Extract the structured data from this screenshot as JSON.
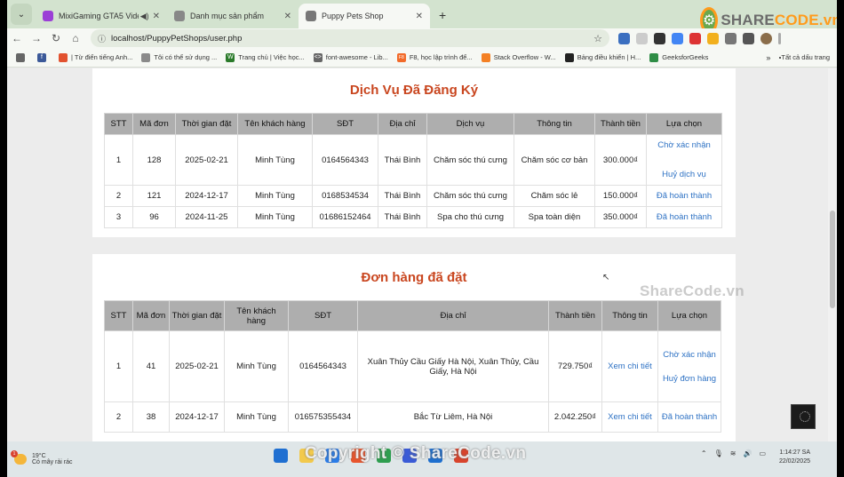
{
  "browser": {
    "tabs": [
      {
        "title": "MixiGaming GTA5 Video Pl",
        "color": "#9b3fd6",
        "audio": "◀)",
        "active": false
      },
      {
        "title": "Danh mục sản phẩm",
        "color": "#888888",
        "active": false
      },
      {
        "title": "Puppy Pets Shop",
        "color": "#777777",
        "active": true
      }
    ],
    "new_tab": "+",
    "url": "localhost/PuppyPetShops/user.php",
    "bookmarks": [
      {
        "label": "",
        "color": "#3b5998",
        "glyph": "f"
      },
      {
        "label": "| Từ điển tiếng Anh...",
        "color": "#e2522f",
        "glyph": ""
      },
      {
        "label": "Tôi có thể sử dụng ...",
        "color": "#8a8a8a",
        "glyph": ""
      },
      {
        "label": "Trang chủ | Việc học...",
        "color": "#2a7a2a",
        "glyph": "W"
      },
      {
        "label": "font-awesome - Lib...",
        "color": "#666666",
        "glyph": "<>"
      },
      {
        "label": "F8, học lập trình để...",
        "color": "#f26a2a",
        "glyph": "F8"
      },
      {
        "label": "Stack Overflow - W...",
        "color": "#f48024",
        "glyph": ""
      },
      {
        "label": "Bảng điều khiển | H...",
        "color": "#222222",
        "glyph": ""
      },
      {
        "label": "GeeksforGeeks",
        "color": "#2f8d46",
        "glyph": ""
      }
    ],
    "bookmarks_more": "»",
    "all_bookmarks": "Tất cả dấu trang"
  },
  "logo": {
    "brand_left": "SHARE",
    "brand_right": "CODE.vn"
  },
  "services": {
    "title": "Dịch Vụ Đã Đăng Ký",
    "headers": [
      "STT",
      "Mã đơn",
      "Thời gian đặt",
      "Tên khách hàng",
      "SĐT",
      "Địa chỉ",
      "Dịch vụ",
      "Thông tin",
      "Thành tiền",
      "Lựa chọn"
    ],
    "rows": [
      {
        "stt": "1",
        "id": "128",
        "date": "2025-02-21",
        "name": "Minh Tùng",
        "phone": "0164564343",
        "address": "Thái Bình",
        "service": "Chăm sóc thú cưng",
        "info": "Chăm sóc cơ bản",
        "total": "300.000₫",
        "action1": "Chờ xác nhận",
        "action2": "Huỷ dịch vụ"
      },
      {
        "stt": "2",
        "id": "121",
        "date": "2024-12-17",
        "name": "Minh Tùng",
        "phone": "0168534534",
        "address": "Thái Bình",
        "service": "Chăm sóc thú cưng",
        "info": "Chăm sóc lẻ",
        "total": "150.000₫",
        "action1": "Đã hoàn thành",
        "action2": ""
      },
      {
        "stt": "3",
        "id": "96",
        "date": "2024-11-25",
        "name": "Minh Tùng",
        "phone": "01686152464",
        "address": "Thái Bình",
        "service": "Spa cho thú cưng",
        "info": "Spa toàn diện",
        "total": "350.000₫",
        "action1": "Đã hoàn thành",
        "action2": ""
      }
    ]
  },
  "orders": {
    "title": "Đơn hàng đã đặt",
    "headers": [
      "STT",
      "Mã đơn",
      "Thời gian đặt",
      "Tên khách hàng",
      "SĐT",
      "Địa chỉ",
      "Thành tiền",
      "Thông tin",
      "Lựa chọn"
    ],
    "rows": [
      {
        "stt": "1",
        "id": "41",
        "date": "2025-02-21",
        "name": "Minh Tùng",
        "phone": "0164564343",
        "address": "Xuân Thủy Cầu Giấy Hà Nội, Xuân Thủy, Cầu Giấy, Hà Nội",
        "total": "729.750₫",
        "info": "Xem chi tiết",
        "action1": "Chờ xác nhận",
        "action2": "Huỷ đơn hàng"
      },
      {
        "stt": "2",
        "id": "38",
        "date": "2024-12-17",
        "name": "Minh Tùng",
        "phone": "016575355434",
        "address": "Bắc Từ Liêm, Hà Nội",
        "total": "2.042.250₫",
        "info": "Xem chi tiết",
        "action1": "Đã hoàn thành",
        "action2": ""
      }
    ]
  },
  "watermarks": {
    "middle": "ShareCode.vn",
    "bottom": "Copyright © ShareCode.vn"
  },
  "taskbar": {
    "weather_temp": "19°C",
    "weather_desc": "Có mây rải rác",
    "weather_badge": "1",
    "apps": [
      "#1f6fd1",
      "#f2c94c",
      "#2b7de9",
      "#e8552d",
      "#2e9e4f",
      "#3a5bd6",
      "#1e6fcf",
      "#d8442c"
    ],
    "time": "1:14:27 SA",
    "date": "22/02/2025"
  },
  "colors": {
    "accent_title": "#c9461f",
    "link": "#2e72c4",
    "header_bg": "#aeaeae"
  }
}
